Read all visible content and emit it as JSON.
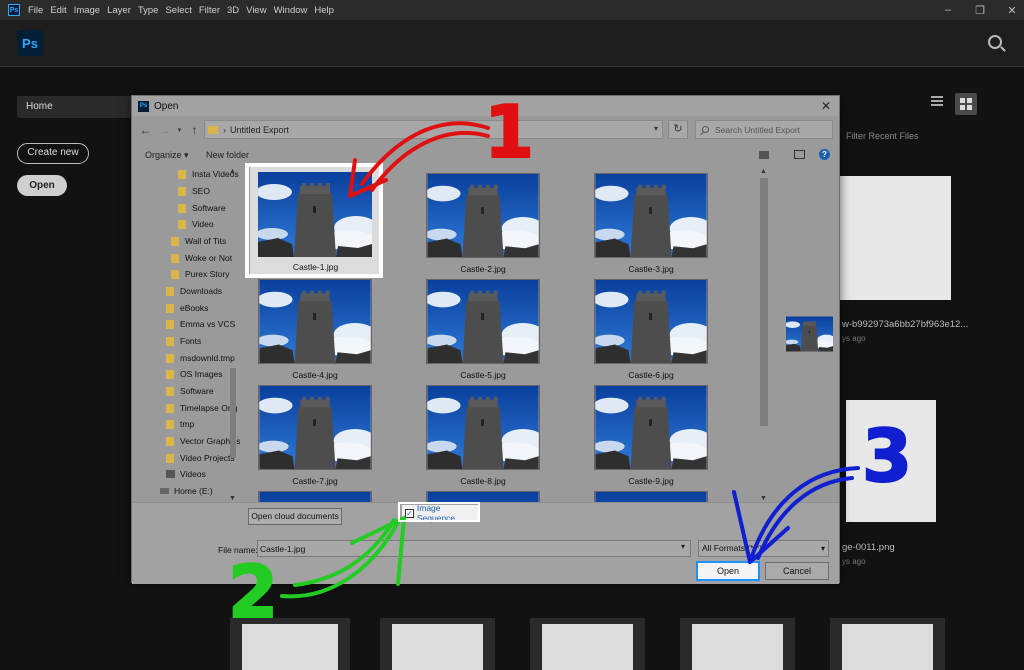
{
  "menu": {
    "app_icon": "Ps",
    "items": [
      "File",
      "Edit",
      "Image",
      "Layer",
      "Type",
      "Select",
      "Filter",
      "3D",
      "View",
      "Window",
      "Help"
    ]
  },
  "window_controls": [
    "minimize-icon",
    "maximize-icon",
    "close-icon"
  ],
  "header": {
    "logo": "Ps",
    "search_icon": "search-icon"
  },
  "home": {
    "tab_label": "Home",
    "create_new": "Create new",
    "open": "Open",
    "filter_recent": "Filter Recent Files",
    "recent": [
      {
        "name": "w-b992973a6bb27bf963e12...",
        "age": "ys ago"
      },
      {
        "name": "ge-0011.png",
        "age": "ys ago"
      }
    ]
  },
  "dialog": {
    "title": "Open",
    "address_path": "Untitled Export",
    "search_placeholder": "Search Untitled Export",
    "toolbar": {
      "organize": "Organize ▾",
      "new_folder": "New folder"
    },
    "tree": [
      {
        "label": "Insta Videos",
        "type": "folder"
      },
      {
        "label": "SEO",
        "type": "folder"
      },
      {
        "label": "Software",
        "type": "folder"
      },
      {
        "label": "Video",
        "type": "folder"
      },
      {
        "label": "Wall of Tits",
        "type": "folder"
      },
      {
        "label": "Woke or Not",
        "type": "folder"
      },
      {
        "label": "Purex Story",
        "type": "folder"
      },
      {
        "label": "Downloads",
        "type": "folder"
      },
      {
        "label": "eBooks",
        "type": "folder"
      },
      {
        "label": "Emma vs VCS",
        "type": "folder"
      },
      {
        "label": "Fonts",
        "type": "folder"
      },
      {
        "label": "msdownld.tmp",
        "type": "folder"
      },
      {
        "label": "OS Images",
        "type": "folder"
      },
      {
        "label": "Software",
        "type": "folder"
      },
      {
        "label": "Timelapse Orig",
        "type": "folder"
      },
      {
        "label": "tmp",
        "type": "folder"
      },
      {
        "label": "Vector Graphics",
        "type": "folder"
      },
      {
        "label": "Video Projects",
        "type": "folder"
      },
      {
        "label": "Videos",
        "type": "video"
      },
      {
        "label": "Home (E:)",
        "type": "drive"
      }
    ],
    "files": [
      "Castle-1.jpg",
      "Castle-2.jpg",
      "Castle-3.jpg",
      "Castle-4.jpg",
      "Castle-5.jpg",
      "Castle-6.jpg",
      "Castle-7.jpg",
      "Castle-8.jpg",
      "Castle-9.jpg"
    ],
    "selected_file": "Castle-1.jpg",
    "cloud_button": "Open cloud documents",
    "image_sequence_label": "Image Sequence",
    "image_sequence_checked": true,
    "file_name_label": "File name:",
    "file_name_value": "Castle-1.jpg",
    "format_value": "All Formats (*.*)",
    "open_button": "Open",
    "cancel_button": "Cancel"
  },
  "annotations": {
    "n1": "1",
    "n1_color": "#e01010",
    "n2": "2",
    "n2_color": "#22cc22",
    "n3": "3",
    "n3_color": "#1020d0"
  }
}
